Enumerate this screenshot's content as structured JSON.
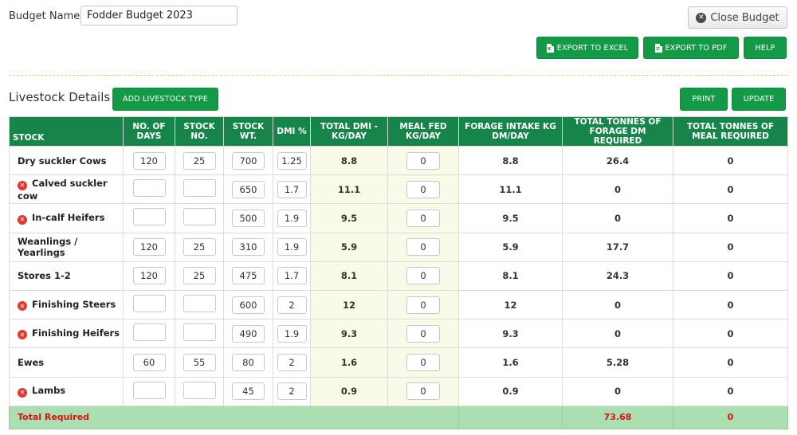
{
  "budget": {
    "label": "Budget Name:",
    "value": "Fodder Budget 2023"
  },
  "toolbar": {
    "close_label": "Close Budget",
    "export_excel": "EXPORT TO EXCEL",
    "export_pdf": "EXPORT TO PDF",
    "help": "HELP"
  },
  "livestock": {
    "title": "Livestock Details",
    "add_label": "ADD LIVESTOCK TYPE",
    "print_label": "PRINT",
    "update_label": "UPDATE"
  },
  "table": {
    "headers": [
      "STOCK",
      "NO. OF DAYS",
      "STOCK NO.",
      "STOCK WT.",
      "DMI %",
      "TOTAL DMI - KG/DAY",
      "MEAL FED KG/DAY",
      "FORAGE INTAKE KG DM/DAY",
      "TOTAL TONNES OF FORAGE DM REQUIRED",
      "TOTAL TONNES OF MEAL REQUIRED"
    ],
    "rows": [
      {
        "name": "Dry suckler Cows",
        "removable": false,
        "days": "120",
        "stock_no": "25",
        "weight": "700",
        "dmi": "1.25",
        "total_dmi": "8.8",
        "meal_fed": "0",
        "forage_intake": "8.8",
        "forage_dm": "26.4",
        "meal_req": "0"
      },
      {
        "name": "Calved suckler cow",
        "removable": true,
        "days": "",
        "stock_no": "",
        "weight": "650",
        "dmi": "1.7",
        "total_dmi": "11.1",
        "meal_fed": "0",
        "forage_intake": "11.1",
        "forage_dm": "0",
        "meal_req": "0"
      },
      {
        "name": "In-calf Heifers",
        "removable": true,
        "days": "",
        "stock_no": "",
        "weight": "500",
        "dmi": "1.9",
        "total_dmi": "9.5",
        "meal_fed": "0",
        "forage_intake": "9.5",
        "forage_dm": "0",
        "meal_req": "0"
      },
      {
        "name": "Weanlings / Yearlings",
        "removable": false,
        "days": "120",
        "stock_no": "25",
        "weight": "310",
        "dmi": "1.9",
        "total_dmi": "5.9",
        "meal_fed": "0",
        "forage_intake": "5.9",
        "forage_dm": "17.7",
        "meal_req": "0"
      },
      {
        "name": "Stores 1-2",
        "removable": false,
        "days": "120",
        "stock_no": "25",
        "weight": "475",
        "dmi": "1.7",
        "total_dmi": "8.1",
        "meal_fed": "0",
        "forage_intake": "8.1",
        "forage_dm": "24.3",
        "meal_req": "0"
      },
      {
        "name": "Finishing Steers",
        "removable": true,
        "days": "",
        "stock_no": "",
        "weight": "600",
        "dmi": "2",
        "total_dmi": "12",
        "meal_fed": "0",
        "forage_intake": "12",
        "forage_dm": "0",
        "meal_req": "0"
      },
      {
        "name": "Finishing Heifers",
        "removable": true,
        "days": "",
        "stock_no": "",
        "weight": "490",
        "dmi": "1.9",
        "total_dmi": "9.3",
        "meal_fed": "0",
        "forage_intake": "9.3",
        "forage_dm": "0",
        "meal_req": "0"
      },
      {
        "name": "Ewes",
        "removable": false,
        "days": "60",
        "stock_no": "55",
        "weight": "80",
        "dmi": "2",
        "total_dmi": "1.6",
        "meal_fed": "0",
        "forage_intake": "1.6",
        "forage_dm": "5.28",
        "meal_req": "0"
      },
      {
        "name": "Lambs",
        "removable": true,
        "days": "",
        "stock_no": "",
        "weight": "45",
        "dmi": "2",
        "total_dmi": "0.9",
        "meal_fed": "0",
        "forage_intake": "0.9",
        "forage_dm": "0",
        "meal_req": "0"
      }
    ],
    "total": {
      "label": "Total Required",
      "forage_dm": "73.68",
      "meal_req": "0"
    }
  },
  "colors": {
    "accent_green": "#149a46",
    "header_green": "#17844a",
    "total_row_bg": "#acdeb2",
    "total_text": "#d01414",
    "remove_icon": "#e03a2e"
  },
  "icons": [
    "close-circle-icon",
    "excel-file-icon",
    "pdf-file-icon",
    "remove-row-icon"
  ]
}
